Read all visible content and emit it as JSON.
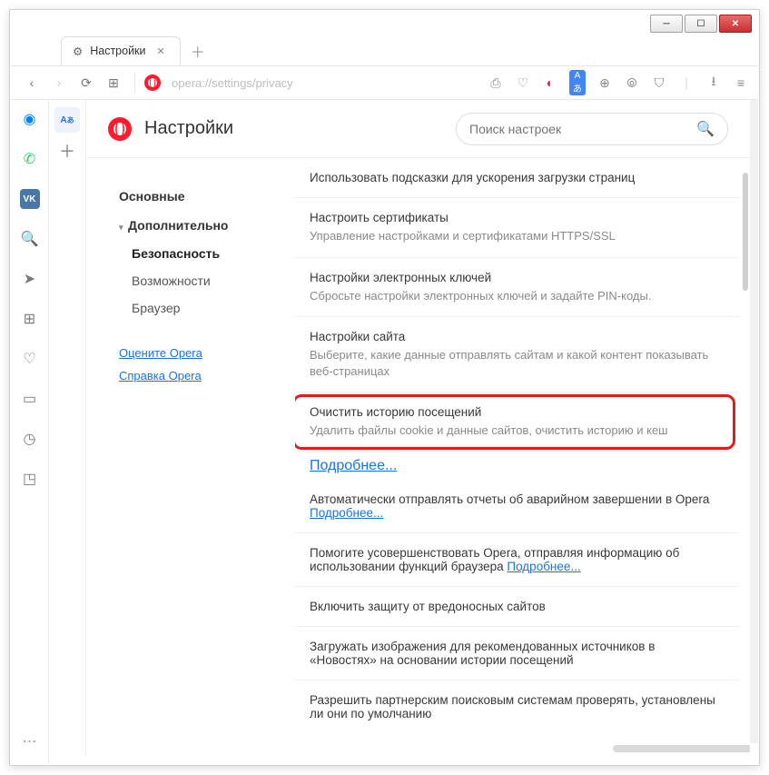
{
  "window": {
    "minimize": "─",
    "maximize": "☐",
    "close": "✕"
  },
  "tab": {
    "title": "Настройки",
    "gear": "⚙"
  },
  "url": "opera://settings/privacy",
  "header": {
    "title": "Настройки"
  },
  "search": {
    "placeholder": "Поиск настроек"
  },
  "sidebar": {
    "basic": "Основные",
    "advanced": "Дополнительно",
    "security": "Безопасность",
    "features": "Возможности",
    "browser": "Браузер",
    "rate": "Оцените Opera",
    "help": "Справка Opera"
  },
  "rows": {
    "hints": {
      "title": "Использовать подсказки для ускорения загрузки страниц"
    },
    "certs": {
      "title": "Настроить сертификаты",
      "desc": "Управление настройками и сертификатами HTTPS/SSL"
    },
    "keys": {
      "title": "Настройки электронных ключей",
      "desc": "Сбросьте настройки электронных ключей и задайте PIN-коды."
    },
    "site": {
      "title": "Настройки сайта",
      "desc": "Выберите, какие данные отправлять сайтам и какой контент показывать веб-страницах"
    },
    "clear": {
      "title": "Очистить историю посещений",
      "desc": "Удалить файлы cookie и данные сайтов, очистить историю и кеш"
    },
    "more": "Подробнее...",
    "crash": {
      "text": "Автоматически отправлять отчеты об аварийном завершении в Opera  ",
      "link": "Подробнее..."
    },
    "improve": {
      "text": "Помогите усовершенствовать Opera, отправляя информацию об использовании функций браузера  ",
      "link": "Подробнее..."
    },
    "malware": {
      "title": "Включить защиту от вредоносных сайтов"
    },
    "news": {
      "title": "Загружать изображения для рекомендованных источников в «Новостях» на основании истории посещений"
    },
    "partners": {
      "title": "Разрешить партнерским поисковым системам проверять, установлены ли они по умолчанию"
    }
  },
  "icons": {
    "back": "‹",
    "fwd": "›",
    "reload": "⟳",
    "speed": "⊞",
    "camera": "⎙",
    "heart": "♡",
    "shield_o": "◐",
    "trans": "Ⓐ",
    "globe": "⊕",
    "vpn": "⦾",
    "shield": "⛉",
    "down": "⭳",
    "menu": "≡",
    "msg": "✉",
    "wa": "✆",
    "vk": "VK",
    "search": "🔍",
    "arrow": "➤",
    "grid": "⊞",
    "heart2": "♡",
    "clip": "▭",
    "clock": "◷",
    "cube": "◳",
    "dots": "⋯",
    "searchglass": "🔍",
    "plus": "＋",
    "lang": "Aあ"
  }
}
